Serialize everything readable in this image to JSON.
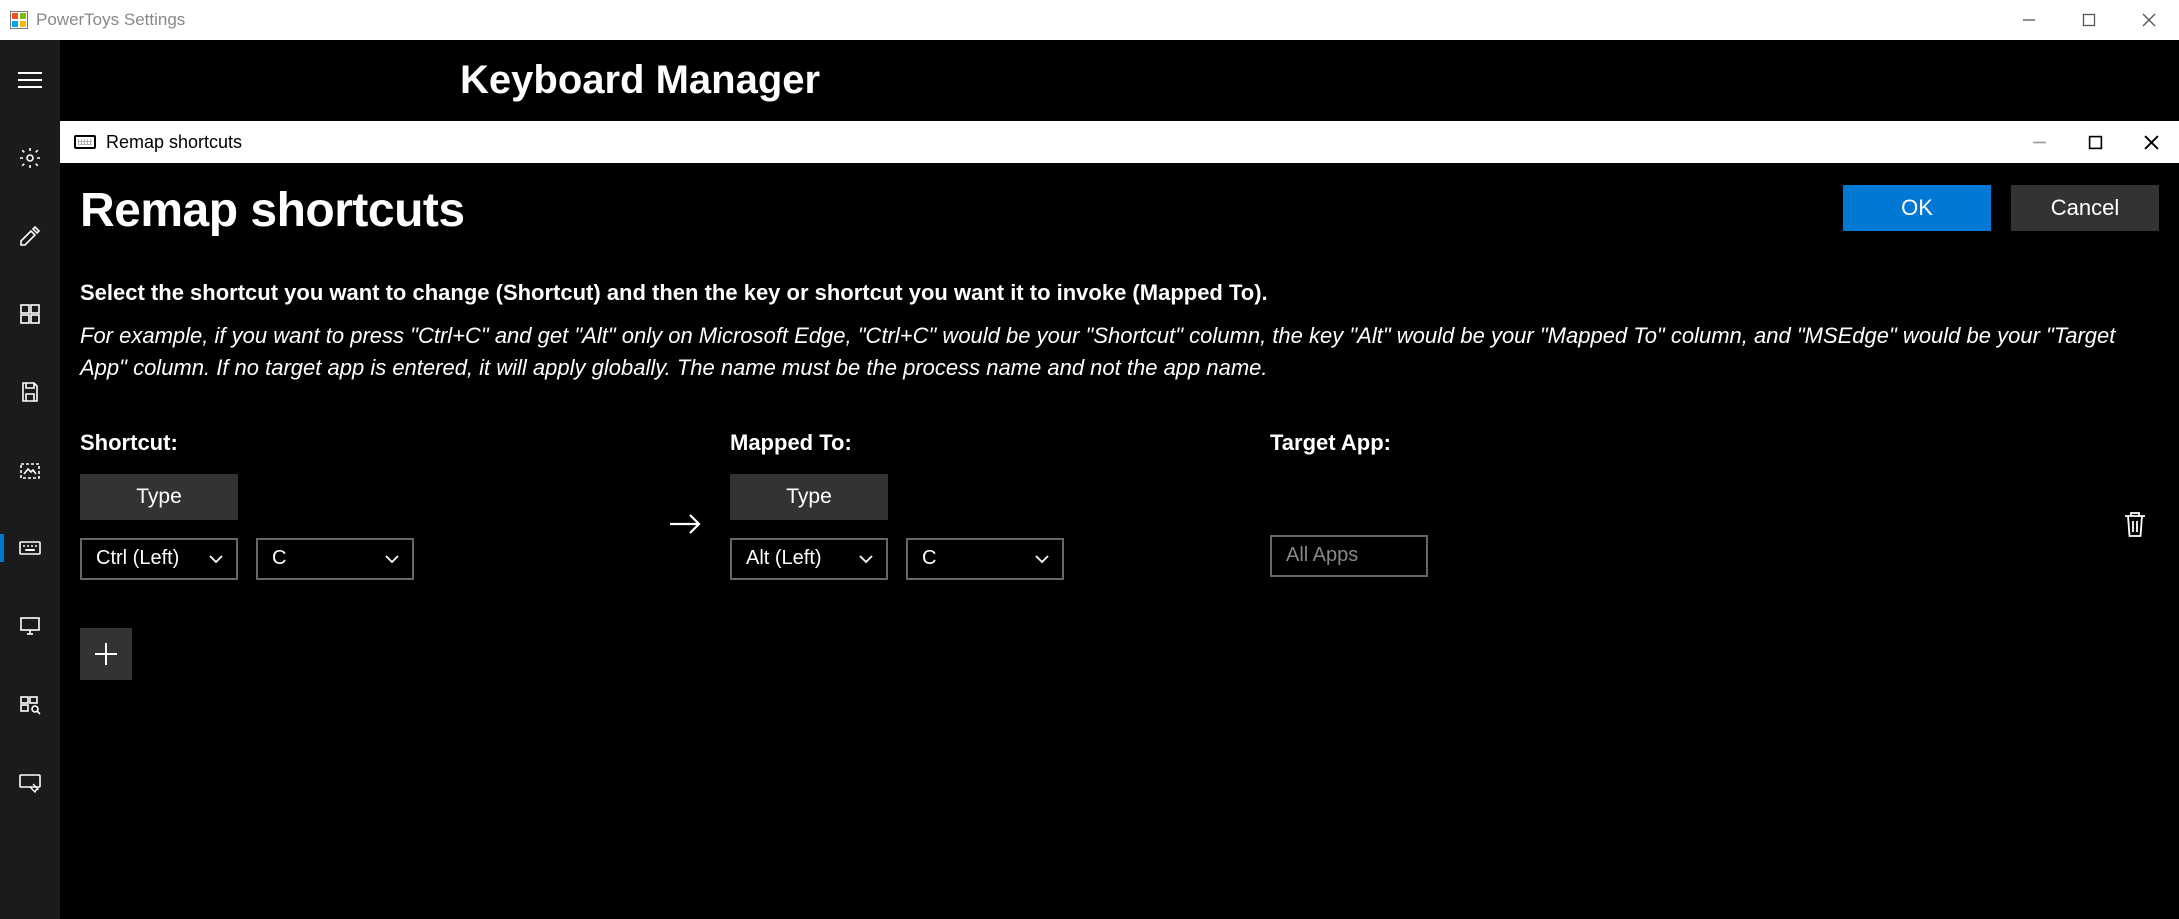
{
  "outer_window": {
    "title": "PowerToys Settings"
  },
  "page": {
    "title": "Keyboard Manager"
  },
  "dialog": {
    "titlebar": "Remap shortcuts",
    "heading": "Remap shortcuts",
    "ok_label": "OK",
    "cancel_label": "Cancel",
    "description": "Select the shortcut you want to change (Shortcut) and then the key or shortcut you want it to invoke (Mapped To).",
    "example": "For example, if you want to press \"Ctrl+C\" and get \"Alt\" only on Microsoft Edge, \"Ctrl+C\" would be your \"Shortcut\" column, the key \"Alt\" would be your \"Mapped To\" column, and \"MSEdge\" would be your \"Target App\" column. If no target app is entered, it will apply globally. The name must be the process name and not the app name.",
    "columns": {
      "shortcut": "Shortcut:",
      "mapped": "Mapped To:",
      "target": "Target App:"
    },
    "type_button": "Type",
    "row": {
      "shortcut_keys": {
        "k1": "Ctrl (Left)",
        "k2": "C"
      },
      "mapped_keys": {
        "k1": "Alt (Left)",
        "k2": "C"
      },
      "target_placeholder": "All Apps"
    }
  },
  "sidebar": {
    "items": [
      "menu",
      "general",
      "color-picker",
      "fancy-zones",
      "file-explorer",
      "image-resizer",
      "keyboard-manager",
      "power-rename",
      "run",
      "shortcut-guide"
    ]
  }
}
